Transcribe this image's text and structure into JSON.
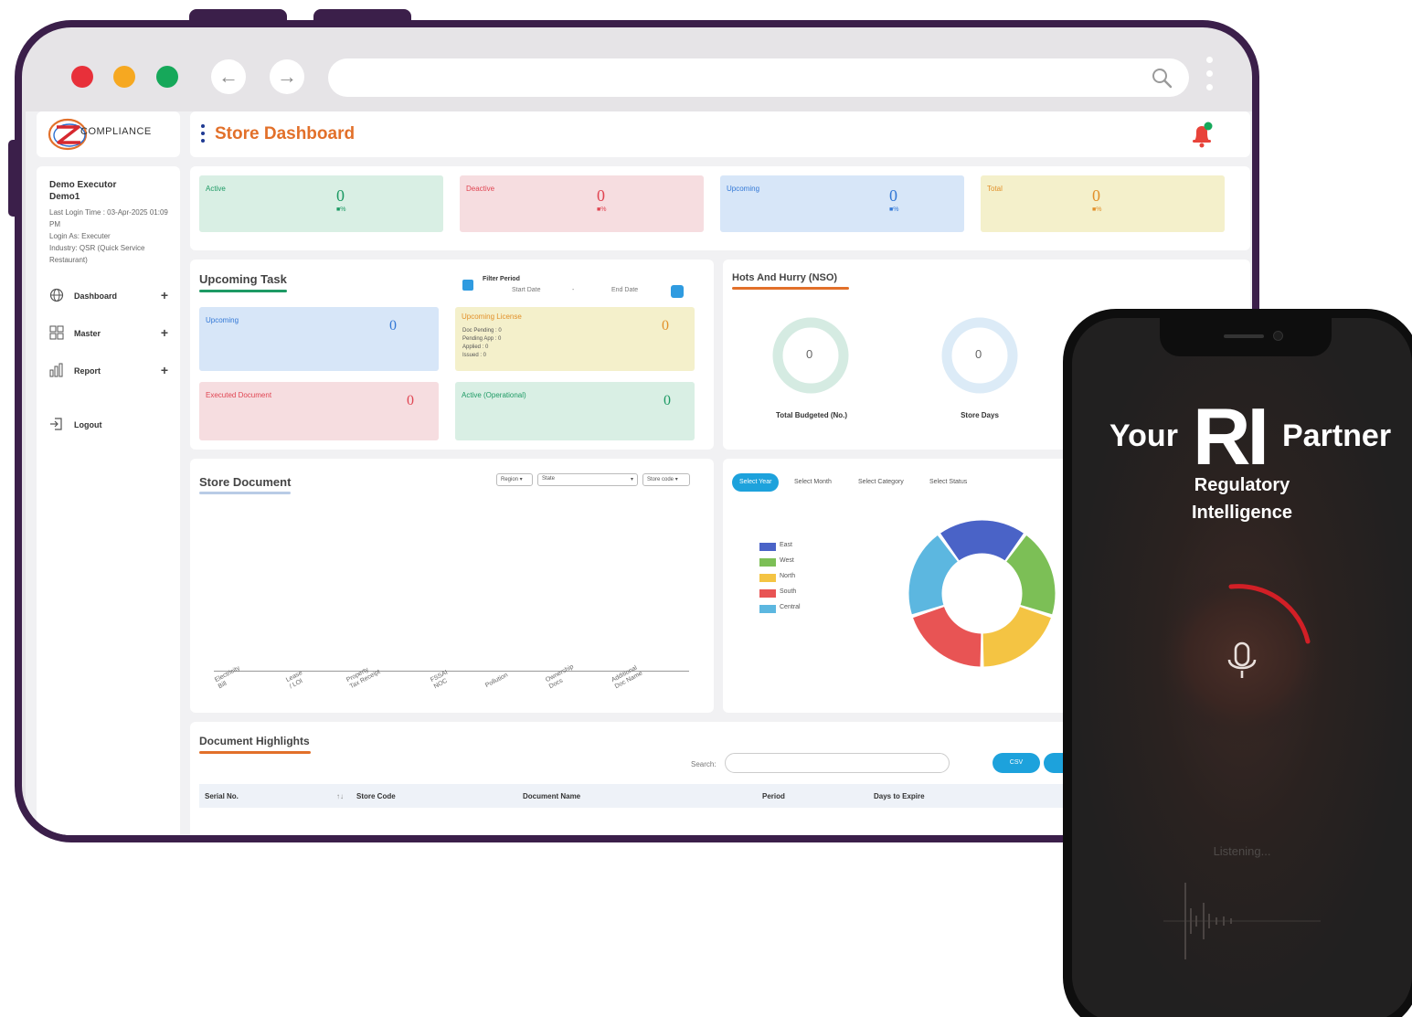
{
  "browser": {
    "back_icon": "arrow-left-icon",
    "forward_icon": "arrow-right-icon",
    "address_value": "",
    "colors": {
      "close": "#e8303a",
      "minimize": "#f6a821",
      "maximize": "#16a85a",
      "frame": "#3b1f4a"
    }
  },
  "brand": {
    "logo_text": "COMPLIANCE",
    "logo_icon": "z-compliance-logo"
  },
  "user": {
    "name_line1": "Demo Executor",
    "name_line2": "Demo1",
    "last_login": "Last Login Time : 03-Apr-2025 01:09 PM",
    "login_as": "Login As: Executer",
    "industry": "Industry: QSR (Quick Service Restaurant)"
  },
  "sidebar": {
    "items": [
      {
        "label": "Dashboard",
        "icon": "globe-icon",
        "expand": "+"
      },
      {
        "label": "Master",
        "icon": "grid-icon",
        "expand": "+"
      },
      {
        "label": "Report",
        "icon": "chart-icon",
        "expand": "+"
      },
      {
        "label": "Logout",
        "icon": "logout-icon",
        "expand": ""
      }
    ]
  },
  "header": {
    "title": "Store Dashboard",
    "bell_icon": "bell-icon"
  },
  "stats": [
    {
      "label": "Active",
      "value": "0",
      "pct": "■%",
      "bg": "#d9efe4",
      "fg": "#1d9a64"
    },
    {
      "label": "Deactive",
      "value": "0",
      "pct": "■%",
      "bg": "#f6dde0",
      "fg": "#e04552"
    },
    {
      "label": "Upcoming",
      "value": "0",
      "pct": "■%",
      "bg": "#d7e6f8",
      "fg": "#3378d6"
    },
    {
      "label": "Total",
      "value": "0",
      "pct": "■%",
      "bg": "#f4f0cb",
      "fg": "#e2902a"
    }
  ],
  "upcoming_task": {
    "title": "Upcoming Task",
    "filter_label": "Filter Period",
    "start_date": "Start Date",
    "dash": "-",
    "end_date": "End Date",
    "cards": [
      {
        "label": "Upcoming",
        "value": "0"
      },
      {
        "label": "Upcoming License",
        "value": "0",
        "list": [
          "Doc Pending : 0",
          "Pending App : 0",
          "Applied : 0",
          "Issued : 0"
        ]
      },
      {
        "label": "Executed Document",
        "value": "0"
      },
      {
        "label": "Active (Operational)",
        "value": "0"
      }
    ]
  },
  "hots": {
    "title": "Hots And Hurry (NSO)",
    "rings": [
      {
        "label": "Total Budgeted (No.)",
        "value": "0"
      },
      {
        "label": "Store Days",
        "value": "0"
      }
    ]
  },
  "store_document": {
    "title": "Store Document",
    "selects": [
      "Region",
      "State",
      "Store code"
    ],
    "x_labels": [
      "Electricity\nBill",
      "Lease\n/ LOI",
      "Property\nTax Receipt",
      "FSSAI\nNOC",
      "Pollution",
      "Ownership\nDocs",
      "Additional\nDoc Name"
    ]
  },
  "region_chart": {
    "tabs": [
      "Select Year",
      "Select Month",
      "Select Category",
      "Select Status"
    ]
  },
  "chart_data": {
    "type": "pie",
    "title": "",
    "categories": [
      "East",
      "West",
      "North",
      "South",
      "Central"
    ],
    "values": [
      20,
      20,
      20,
      20,
      20
    ],
    "colors": [
      "#4a63c7",
      "#7cbf56",
      "#f4c443",
      "#e85454",
      "#5cb7e0"
    ],
    "donut": true,
    "legend_position": "left"
  },
  "highlights": {
    "title": "Document Highlights",
    "search_label": "Search:",
    "search_value": "",
    "csv_label": "CSV",
    "columns": [
      "Serial No.",
      "Store Code",
      "Document Name",
      "Period",
      "Days to Expire"
    ],
    "sort_glyph": "↑↓"
  },
  "phone": {
    "your": "Your",
    "ri": "RI",
    "partner": "Partner",
    "sub_line1": "Regulatory",
    "sub_line2": "Intelligence",
    "mic_icon": "microphone-icon",
    "listening": "Listening..."
  }
}
